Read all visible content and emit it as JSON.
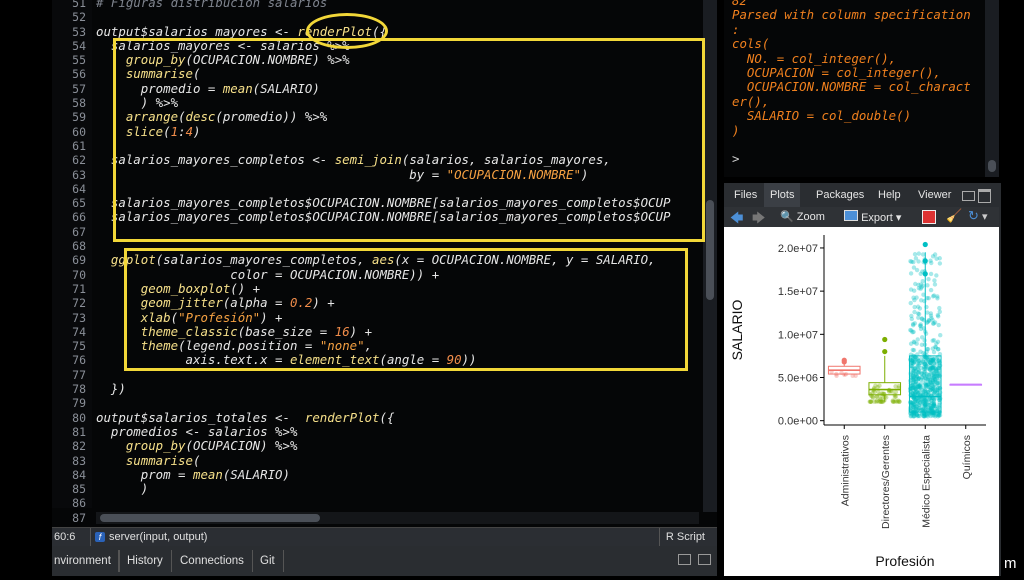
{
  "editor": {
    "line_numbers": [
      "51",
      "52",
      "53",
      "54",
      "55",
      "56",
      "57",
      "58",
      "59",
      "60",
      "61",
      "62",
      "63",
      "64",
      "65",
      "66",
      "67",
      "68",
      "69",
      "70",
      "71",
      "72",
      "73",
      "74",
      "75",
      "76",
      "77",
      "78",
      "79",
      "80",
      "81",
      "82",
      "83",
      "84",
      "85",
      "86",
      "87"
    ],
    "lines": [
      "# Figuras distribucion salarios",
      "",
      "output$salarios_mayores <- renderPlot({",
      "  salarios_mayores <- salarios %>%",
      "    group_by(OCUPACION.NOMBRE) %>%",
      "    summarise(",
      "      promedio = mean(SALARIO)",
      "      ) %>%",
      "    arrange(desc(promedio)) %>%",
      "    slice(1:4)",
      "",
      "  salarios_mayores_completos <- semi_join(salarios, salarios_mayores,",
      "                                          by = \"OCUPACION.NOMBRE\")",
      "",
      "  salarios_mayores_completos$OCUPACION.NOMBRE[salarios_mayores_completos$OCUP",
      "  salarios_mayores_completos$OCUPACION.NOMBRE[salarios_mayores_completos$OCUP",
      "",
      "",
      "  ggplot(salarios_mayores_completos, aes(x = OCUPACION.NOMBRE, y = SALARIO,",
      "                  color = OCUPACION.NOMBRE)) +",
      "      geom_boxplot() +",
      "      geom_jitter(alpha = 0.2) +",
      "      xlab(\"Profesión\") +",
      "      theme_classic(base_size = 16) +",
      "      theme(legend.position = \"none\",",
      "            axis.text.x = element_text(angle = 90))",
      "",
      "  })",
      "",
      "output$salarios_totales <-  renderPlot({",
      "  promedios <- salarios %>%",
      "    group_by(OCUPACION) %>%",
      "    summarise(",
      "      prom = mean(SALARIO)",
      "      )",
      "",
      ""
    ]
  },
  "statusbar": {
    "cursor": "60:6",
    "function_icon": "f",
    "function": "server(input, output)",
    "language": "R Script"
  },
  "bottom_tabs": [
    "nvironment",
    "History",
    "Connections",
    "Git"
  ],
  "console": {
    "lines": [
      "82",
      "Parsed with column specification",
      ":",
      "cols(",
      "  NO. = col_integer(),",
      "  OCUPACION = col_integer(),",
      "  OCUPACION.NOMBRE = col_charact",
      "er(),",
      "  SALARIO = col_double()",
      ")",
      "",
      "> "
    ]
  },
  "pane_tabs": [
    "Files",
    "Plots",
    "Packages",
    "Help",
    "Viewer"
  ],
  "active_pane_tab": "Plots",
  "toolbar": {
    "zoom_label": "Zoom",
    "export_label": "Export"
  },
  "right_strip_text": "m",
  "chart_data": {
    "type": "boxplot",
    "xlabel": "Profesión",
    "ylabel": "SALARIO",
    "y_tick_labels": [
      "0.0e+00",
      "5.0e+06",
      "1.0e+07",
      "1.5e+07",
      "2.0e+07"
    ],
    "y_ticks": [
      0,
      5000000,
      10000000,
      15000000,
      20000000
    ],
    "ylim": [
      -500000,
      21500000
    ],
    "categories": [
      "Administrativos",
      "Directores/Gerentes",
      "Médico Especialista",
      "Químicos"
    ],
    "colors": [
      "#f0766d",
      "#7cae00",
      "#00bfc4",
      "#c77cff"
    ],
    "boxes": [
      {
        "min": 5200000,
        "q1": 5400000,
        "median": 5850000,
        "q3": 6300000,
        "max": 6700000
      },
      {
        "min": 2200000,
        "q1": 3000000,
        "median": 3600000,
        "q3": 4400000,
        "max": 7500000
      },
      {
        "min": 500000,
        "q1": 1000000,
        "median": 2800000,
        "q3": 7500000,
        "max": 19500000
      },
      {
        "min": 4200000,
        "q1": 4200000,
        "median": 4200000,
        "q3": 4200000,
        "max": 4200000
      }
    ],
    "outliers": [
      [
        6800000,
        7000000
      ],
      [
        8000000,
        9400000
      ],
      [
        17000000,
        18500000,
        20400000
      ],
      []
    ],
    "grid": false,
    "legend": "none"
  },
  "colors": {
    "editor_bg": "#050607",
    "highlight": "#f2d738",
    "console_text": "#f0801e",
    "keyword": "#f6e08a",
    "string": "#f5a142"
  }
}
